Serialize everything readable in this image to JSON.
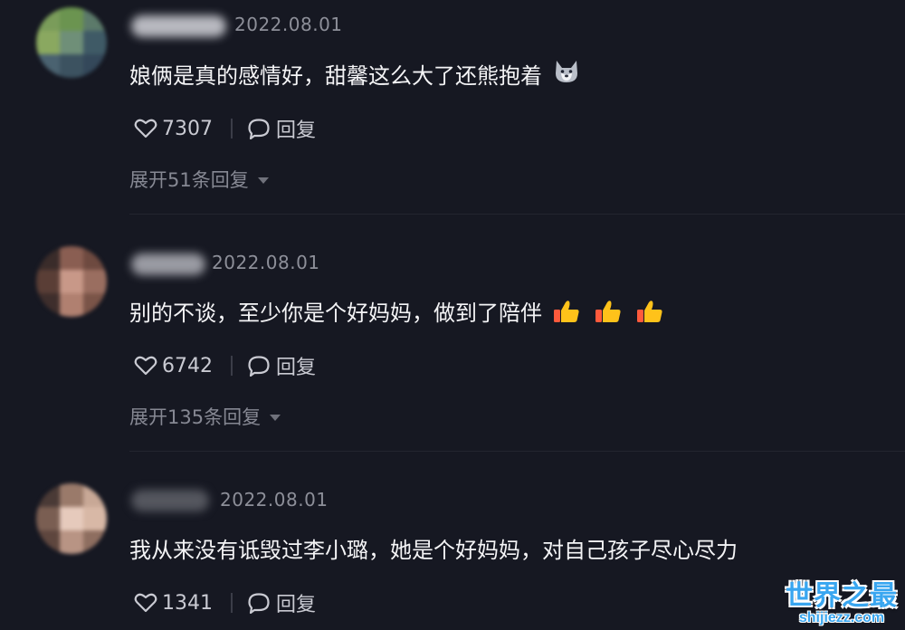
{
  "comments": [
    {
      "date": "2022.08.01",
      "text": "娘俩是真的感情好，甜馨这么大了还熊抱着",
      "emoji": "husky-face-icon",
      "likes": "7307",
      "reply_label": "回复",
      "expand_label": "展开51条回复"
    },
    {
      "date": "2022.08.01",
      "text": "别的不谈，至少你是个好妈妈，做到了陪伴",
      "emoji": "thumbs-up-icon",
      "likes": "6742",
      "reply_label": "回复",
      "expand_label": "展开135条回复"
    },
    {
      "date": "2022.08.01",
      "text": "我从来没有诋毁过李小璐，她是个好妈妈，对自己孩子尽心尽力",
      "likes": "1341",
      "reply_label": "回复"
    }
  ],
  "watermark": {
    "title": "世界之最",
    "url": "shijiezz.com"
  },
  "colors": {
    "background": "#161822",
    "text": "#f4f4f6",
    "muted": "#8d8f99",
    "watermark": "#39a6f0"
  }
}
